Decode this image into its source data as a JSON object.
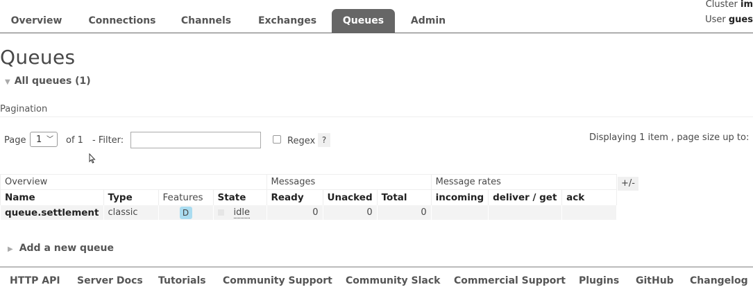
{
  "nav": {
    "tabs": [
      {
        "label": "Overview"
      },
      {
        "label": "Connections"
      },
      {
        "label": "Channels"
      },
      {
        "label": "Exchanges"
      },
      {
        "label": "Queues",
        "active": true
      },
      {
        "label": "Admin"
      }
    ],
    "cluster_label": "Cluster",
    "cluster_value": "im",
    "user_label": "User",
    "user_value": "gues"
  },
  "page": {
    "title": "Queues",
    "section_toggle": "All queues (1)",
    "pagination_heading": "Pagination"
  },
  "pagination": {
    "page_label": "Page",
    "page_value": "1",
    "of_label": "of 1",
    "filter_label": "- Filter:",
    "filter_value": "",
    "regex_label": "Regex",
    "regex_checked": false,
    "help": "?",
    "displaying": "Displaying 1 item , page size up to:"
  },
  "table": {
    "groups": [
      "Overview",
      "Messages",
      "Message rates"
    ],
    "columns": [
      "Name",
      "Type",
      "Features",
      "State",
      "Ready",
      "Unacked",
      "Total",
      "incoming",
      "deliver / get",
      "ack"
    ],
    "rows": [
      {
        "name": "queue.settlement",
        "type": "classic",
        "feature": "D",
        "state": "idle",
        "ready": "0",
        "unacked": "0",
        "total": "0",
        "incoming": "",
        "deliver_get": "",
        "ack": ""
      }
    ],
    "toggle_columns": "+/-"
  },
  "add_queue": "Add a new queue",
  "footer": {
    "links": [
      "HTTP API",
      "Server Docs",
      "Tutorials",
      "Community Support",
      "Community Slack",
      "Commercial Support",
      "Plugins",
      "GitHub",
      "Changelog"
    ]
  },
  "colors": {
    "active_tab": "#666666",
    "feature_badge": "#aadcf0",
    "row_bg": "#f3f3f3"
  }
}
